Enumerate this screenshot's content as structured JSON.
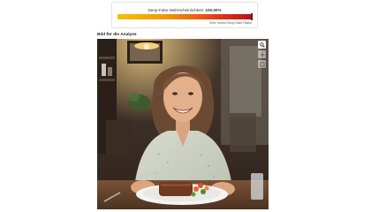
{
  "deepfake": {
    "label": "Deep-Fake-Wahrscheinlichkeit:",
    "value_text": "100.00%",
    "probability": 1.0,
    "scale_note": "Sehr hohes Deep-Fake Risiko",
    "colors": {
      "low": "#f2c200",
      "mid": "#f39a00",
      "high": "#e8431a",
      "max": "#b80f1f"
    }
  },
  "analysis_image": {
    "title": "Bild für die Analyse",
    "alt": "Smiling woman seated at a table with a plate of food",
    "tools": [
      {
        "icon": "zoom-in-icon"
      },
      {
        "icon": "pan-icon"
      },
      {
        "icon": "fit-screen-icon"
      }
    ]
  }
}
